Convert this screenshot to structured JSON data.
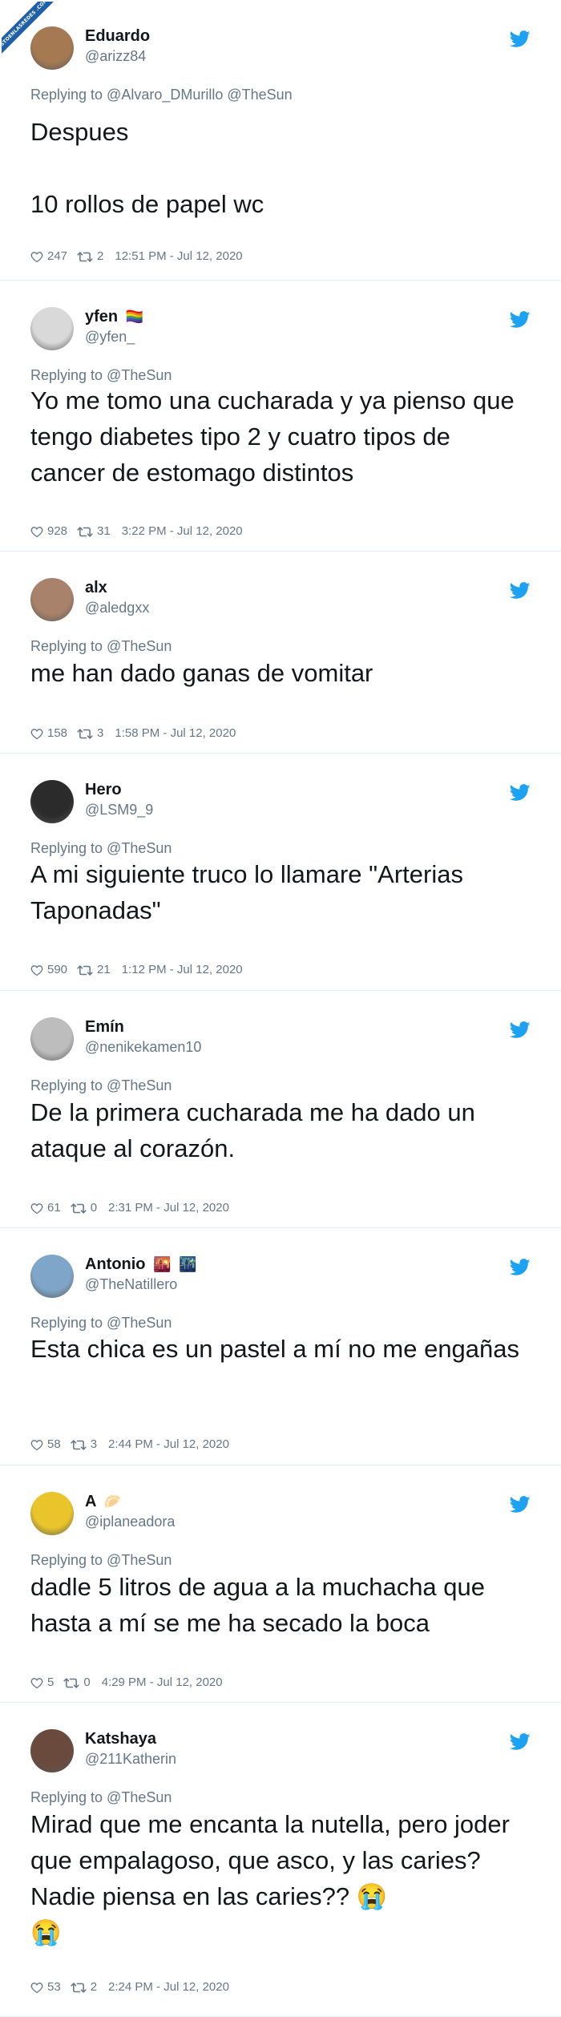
{
  "watermark": {
    "text": "VISTOENLASREDES .COM"
  },
  "tweets": [
    {
      "name": "Eduardo",
      "name_emoji": "",
      "handle": "@arizz84",
      "reply": "Replying to @Alvaro_DMurillo @TheSun",
      "text": "Despues\n\n10 rollos de papel wc",
      "likes": "247",
      "retweets": "2",
      "time": "12:51 PM - Jul 12, 2020",
      "avatar_color": "#a57a52"
    },
    {
      "name": "yfen",
      "name_emoji": "🏳️‍🌈",
      "handle": "@yfen_",
      "reply": "Replying to @TheSun",
      "text": "Yo me tomo una cucharada y ya pienso que tengo diabetes tipo 2 y cuatro tipos de cancer de estomago distintos",
      "likes": "928",
      "retweets": "31",
      "time": "3:22 PM - Jul 12, 2020",
      "avatar_color": "#d9d9d9"
    },
    {
      "name": "alx",
      "name_emoji": "",
      "handle": "@aledgxx",
      "reply": "Replying to @TheSun",
      "text": "me han dado ganas de vomitar",
      "likes": "158",
      "retweets": "3",
      "time": "1:58 PM - Jul 12, 2020",
      "avatar_color": "#a8826a"
    },
    {
      "name": "Hero",
      "name_emoji": "",
      "handle": "@LSM9_9",
      "reply": "Replying to @TheSun",
      "text": "A mi siguiente truco lo llamare \"Arterias Taponadas\"",
      "likes": "590",
      "retweets": "21",
      "time": "1:12 PM - Jul 12, 2020",
      "avatar_color": "#2b2b2b"
    },
    {
      "name": "Emín",
      "name_emoji": "",
      "handle": "@nenikekamen10",
      "reply": "Replying to @TheSun",
      "text": "De la primera cucharada me ha dado un ataque al corazón.",
      "likes": "61",
      "retweets": "0",
      "time": "2:31 PM - Jul 12, 2020",
      "avatar_color": "#bdbdbd"
    },
    {
      "name": "Antonio",
      "name_emoji": "🌇",
      "name_emoji_after": "🌃",
      "handle": "@TheNatillero",
      "reply": "Replying to @TheSun",
      "text": "Esta chica es un pastel a mí no me engañas",
      "likes": "58",
      "retweets": "3",
      "time": "2:44 PM - Jul 12, 2020",
      "avatar_color": "#7fa6c8"
    },
    {
      "name": "A",
      "name_emoji": "🥟",
      "handle": "@iplaneadora",
      "reply": "Replying to @TheSun",
      "text": "dadle 5 litros de agua a la muchacha que hasta a mí se me ha secado la boca",
      "likes": "5",
      "retweets": "0",
      "time": "4:29 PM - Jul 12, 2020",
      "avatar_color": "#e9c42a"
    },
    {
      "name": "Katshaya",
      "name_emoji": "",
      "handle": "@211Katherin",
      "reply": "Replying to @TheSun",
      "text": "Mirad que me encanta la nutella, pero joder que empalagoso, que asco, y las caries? Nadie piensa en las caries?? 😭\n😭",
      "likes": "53",
      "retweets": "2",
      "time": "2:24 PM - Jul 12, 2020",
      "avatar_color": "#6b4a3e"
    }
  ]
}
